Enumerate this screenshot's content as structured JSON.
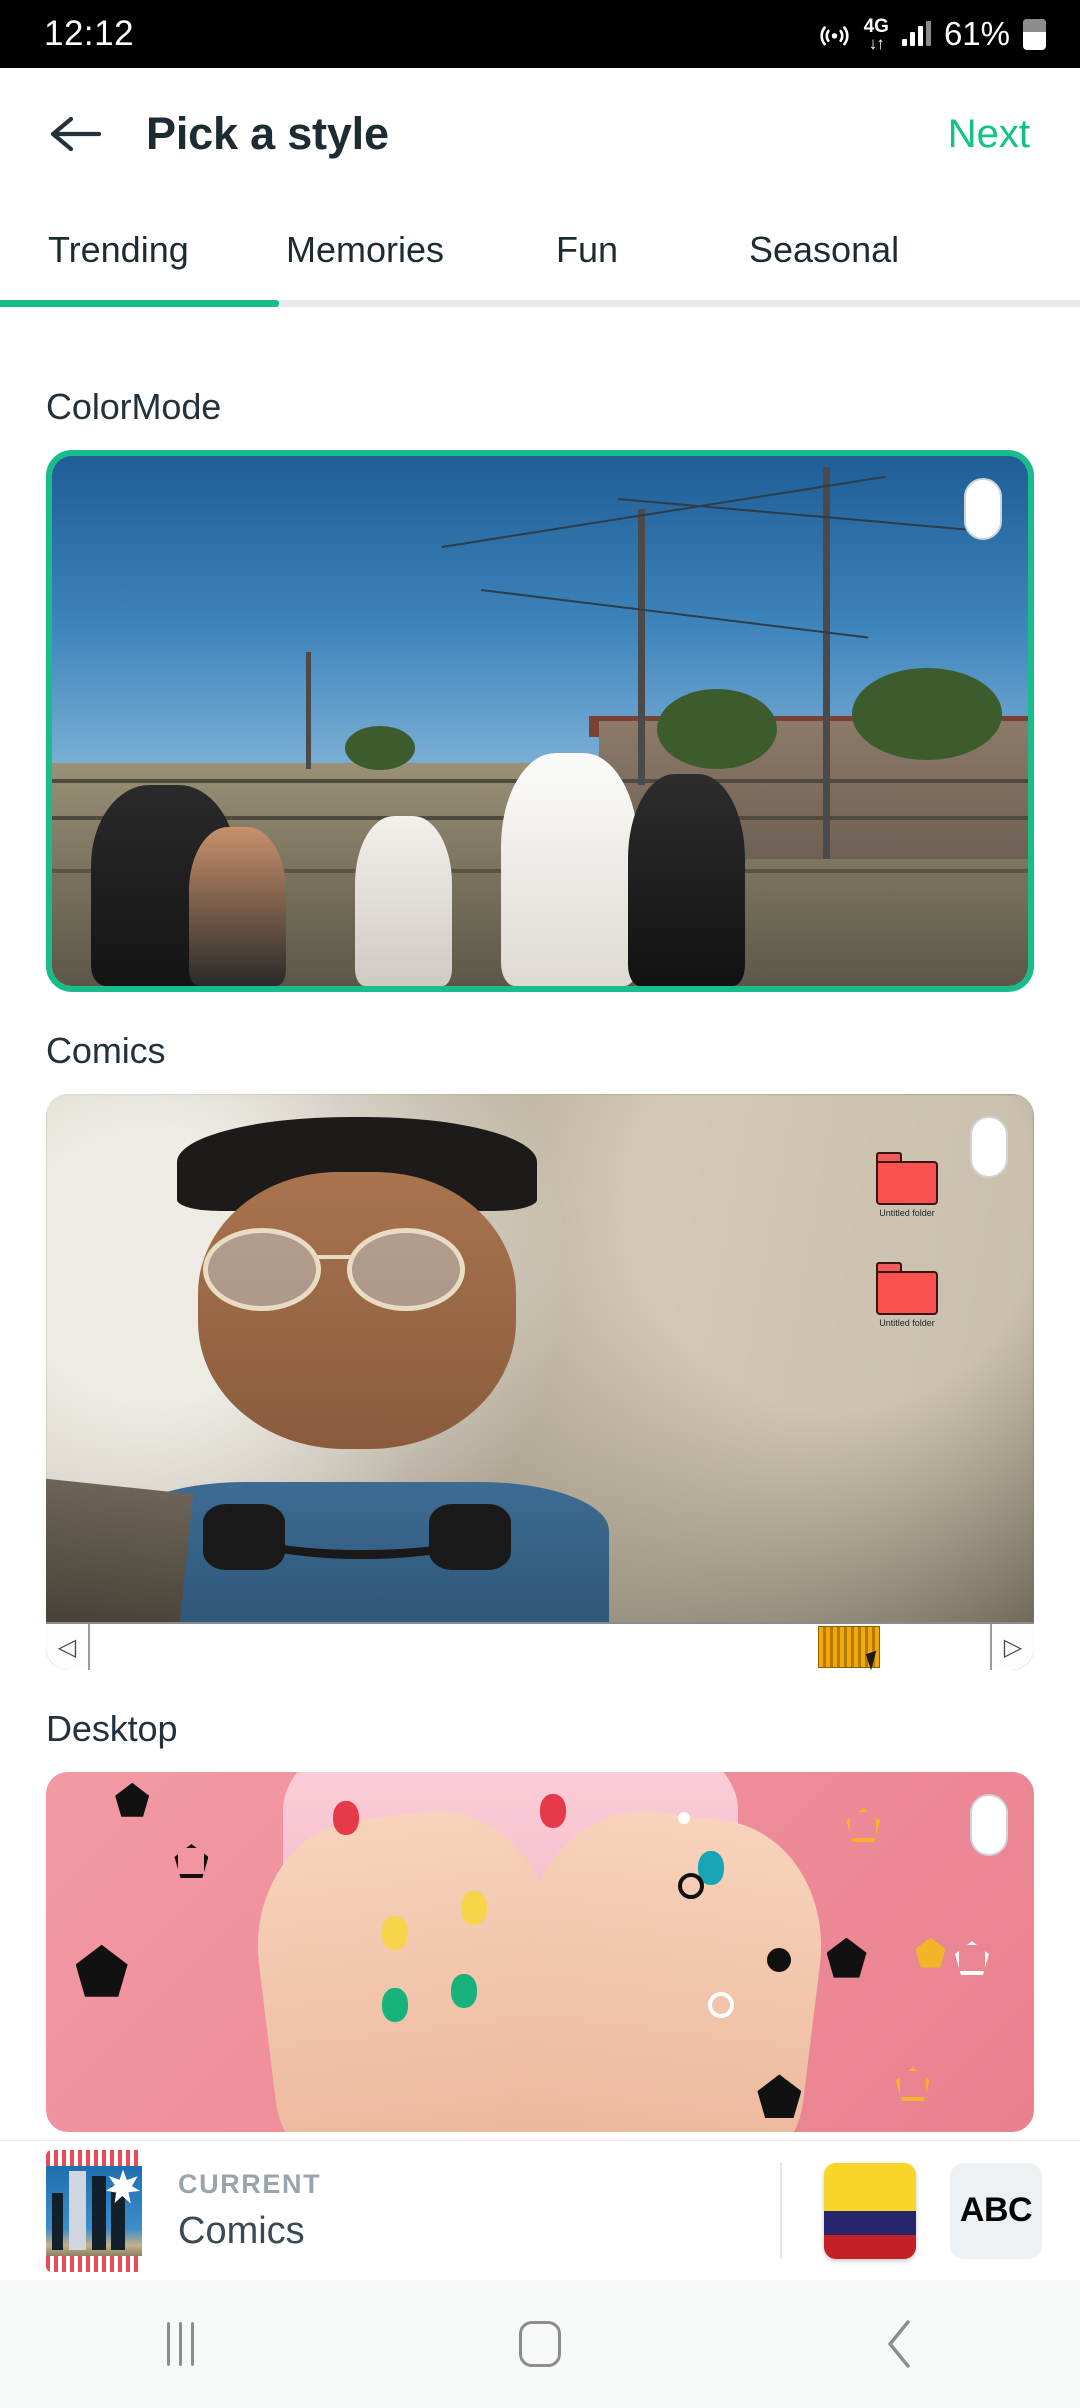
{
  "status_bar": {
    "time": "12:12",
    "battery_percent": "61%",
    "icons": [
      "hotspot-icon",
      "4g-data-icon",
      "signal-bars-icon",
      "battery-icon"
    ],
    "network_label": "4G",
    "network_arrows": "↓↑"
  },
  "header": {
    "back_icon": "back-arrow-icon",
    "title": "Pick a style",
    "next_label": "Next"
  },
  "tabs": {
    "items": [
      {
        "label": "Trending",
        "active": true
      },
      {
        "label": "Memories",
        "active": false
      },
      {
        "label": "Fun",
        "active": false
      },
      {
        "label": "Seasonal",
        "active": false
      }
    ]
  },
  "sections": [
    {
      "label": "ColorMode",
      "selected": true,
      "badge": "preview-pill"
    },
    {
      "label": "Comics",
      "selected": false,
      "badge": "preview-pill"
    },
    {
      "label": "Desktop",
      "selected": false,
      "badge": "preview-pill"
    }
  ],
  "desktop_overlay": {
    "folder_labels": [
      "Untitled folder",
      "Untitled folder"
    ],
    "scrollbar": {
      "left_arrow": "◁",
      "right_arrow": "▷",
      "thumb_name": "horizontal-scroll-thumb"
    }
  },
  "bottom_bar": {
    "kicker": "CURRENT",
    "name": "Comics",
    "flag_button": "colombia-flag-button",
    "abc_label": "ABC"
  },
  "nav_bar": {
    "recents": "recents-icon",
    "home": "home-icon",
    "back": "back-icon"
  },
  "colors": {
    "accent_green": "#19bd8c",
    "next_green": "#0ec47e",
    "title_dark": "#1d2b33",
    "status_bar_bg": "#000000",
    "flag_yellow": "#f8d629",
    "flag_blue": "#26266e",
    "flag_red": "#c32026",
    "folder_red": "#f9524f",
    "scroll_thumb_orange": "#f0a90b"
  }
}
